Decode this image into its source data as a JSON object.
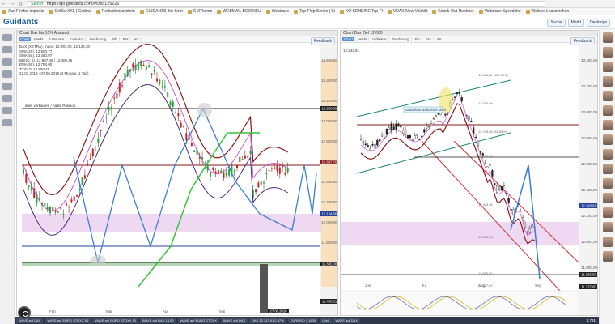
{
  "browser": {
    "secure_label": "Sicher",
    "url": "https://go.guidants.com/#c/tv/125221"
  },
  "bookmarks": [
    "Aus Firefox importie",
    "Größe XXL | Godmo",
    "Redaktionssystem",
    "GUIDANTS 3er Kom",
    "GMThome",
    "WEBMAIL BOO NEU",
    "Webinare",
    "Top-Flop Serien | Si",
    "KO SCHEINE Top-Fl",
    "VDAX-New Volatilit",
    "Knock-Out-Rechner",
    "Vodafone Speedche",
    "Weitere Lesezeichen"
  ],
  "app": {
    "logo": "Guidants",
    "header_buttons": [
      "Suche",
      "Markt",
      "Desktops"
    ]
  },
  "left_chart": {
    "title": "Chart Dax bis 10% Abstand",
    "toolbar": [
      "Chart",
      "Markt",
      "4 Monate",
      "Indikator",
      "Zeichnung",
      "Fib",
      "Eta",
      "Atr"
    ],
    "feedback_label": "Feedback",
    "legend": [
      "DAX (XETRA), Index: 12.097,00, 12.124,30",
      "SMA(20), 12.500,77",
      "SMA(50), 12.450,97",
      "BB(20, 2), 12.907,45 / 12.400,45",
      "EMA(50), 12.794,00",
      "TTYL 0, 12.850,45"
    ],
    "date_range": "22.01.2018 - 07.06.2018  (4 Monate, 1 Tag)",
    "annotation": "alles verkaufen / halbe Position",
    "y_labels": [
      "13.600,00",
      "13.400,00",
      "13.200,00",
      "13.000,00",
      "12.800,00",
      "12.600,00",
      "12.400,00",
      "12.200,00",
      "12.000,00",
      "11.800,00",
      "11.600,00"
    ],
    "x_labels": [
      "Feb",
      "Mär",
      "Apr",
      "Mai",
      "Jun"
    ],
    "price_badges": [
      {
        "label": "12.800,00",
        "color": "#222"
      },
      {
        "label": "12.647,70",
        "color": "#8b1a1a"
      },
      {
        "label": "12.124,30",
        "color": "#26449a"
      },
      {
        "label": "11.865,00",
        "color": "#222"
      },
      {
        "label": "11.450,31",
        "color": "#222"
      }
    ],
    "footer_date": "27.06.2018"
  },
  "right_chart": {
    "title": "Chart Dax Ziel 12.000",
    "toolbar": [
      "Chart",
      "Markt",
      "Indikator",
      "Zeichnung",
      "Fib",
      "Eta",
      "Atr"
    ],
    "feedback_label": "Feedback",
    "legend_value": "12.343,91",
    "annotation": "Grandiose Bullenfalle oben",
    "fib_labels": [
      "13.118,86 (100.00%)",
      "13.000,00",
      "12.745,00 (61.80%)",
      "12.600,00",
      "12.343,91",
      "12.000,00",
      "11.865,00",
      "11.727,00"
    ],
    "y_labels": [
      "13.400,00",
      "13.200,00",
      "13.000,00",
      "12.800,00",
      "12.600,00",
      "12.400,00",
      "12.200,00",
      "12.000,00",
      "11.800,00"
    ],
    "x_labels": [
      "Jun",
      "Jul",
      "Aug",
      "Sep"
    ],
    "price_badges": [
      {
        "label": "12.343,91",
        "color": "#26449a"
      },
      {
        "label": "11.865,00",
        "color": "#222"
      },
      {
        "label": "11.727,00",
        "color": "#222"
      }
    ]
  },
  "taskbar": {
    "items": [
      "WAVE auf DAX",
      "WAVE auf EURO STOXX 50",
      "WAVE auf EURO STOXX 50",
      "WAVE auf DAX 13.00",
      "WAVE auf EURO STOXX",
      "WAVE auf DAX",
      "DAX 12.343,91 0.37%",
      "EUR/USD 1.1630",
      "Gold",
      "WAVE auf DAX"
    ],
    "clock": "4.791"
  }
}
